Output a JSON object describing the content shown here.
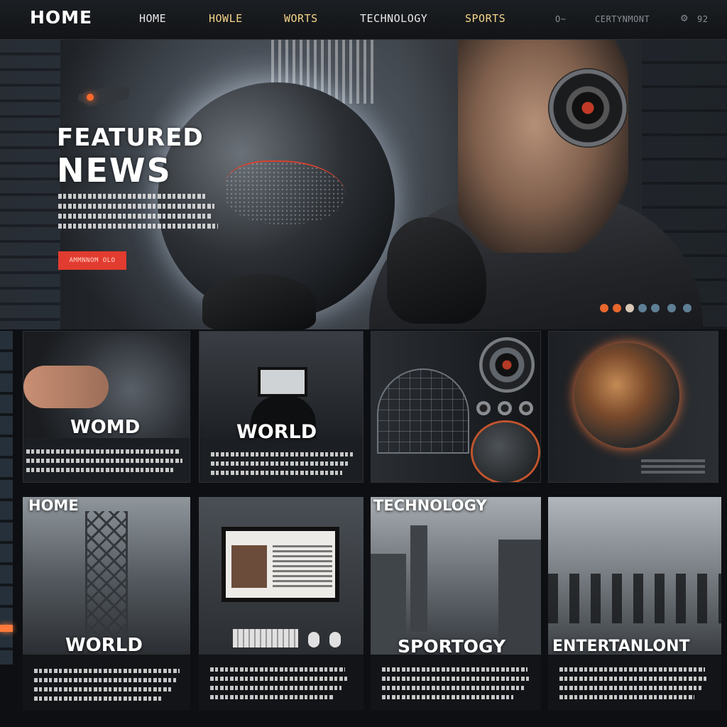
{
  "nav": {
    "logo": "HOME",
    "links": [
      "HOME",
      "HOWLE",
      "WORTS",
      "TECHNOLOGY",
      "SPORTS"
    ],
    "extra_left": "O~",
    "extra_right": "CERTYNMONT",
    "icon_text": "92"
  },
  "hero": {
    "title_line1": "FEATURED",
    "title_line2": "NEWS",
    "button_label": "AMMNNOM OLO"
  },
  "cards_row1": [
    {
      "title": "WOMD"
    },
    {
      "title": "WORLD"
    },
    {
      "title": ""
    },
    {
      "title": ""
    }
  ],
  "cards_row2": [
    {
      "top_label": "HOME",
      "title": "WORLD"
    },
    {
      "top_label": "",
      "title": ""
    },
    {
      "top_label": "TECHNOLOGY",
      "title": "SPORTOGY"
    },
    {
      "top_label": "",
      "title": "ENTERTANLONT"
    }
  ],
  "colors": {
    "accent_red": "#e23b2f",
    "nav_gold": "#f4d48a",
    "background": "#0d0f12"
  }
}
